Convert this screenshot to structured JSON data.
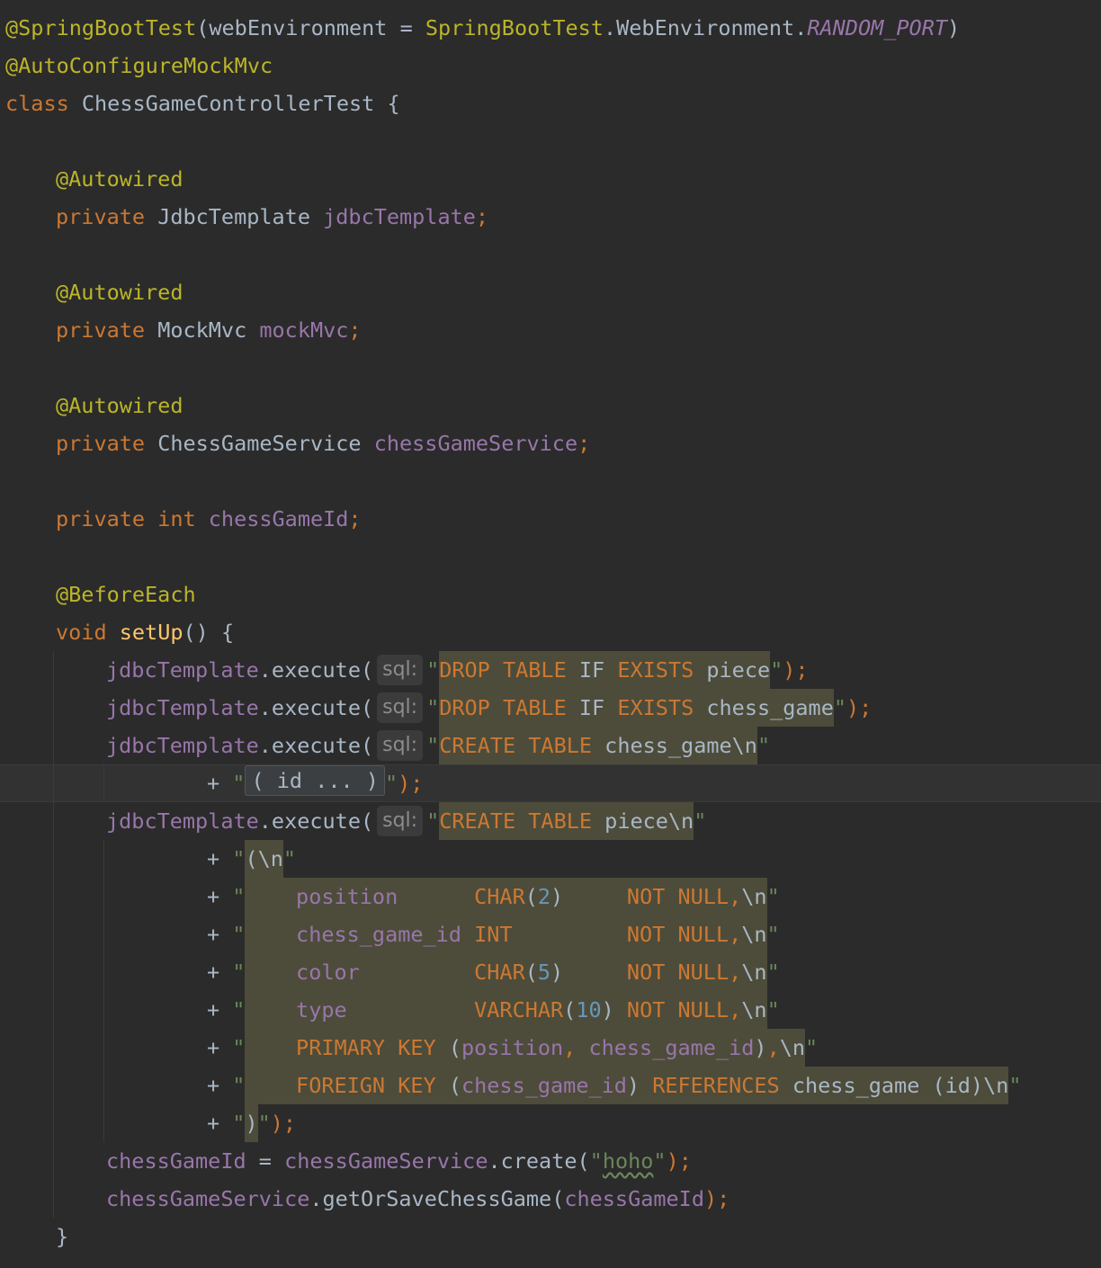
{
  "editor": {
    "lines": [
      {
        "indent": 0,
        "segments": [
          {
            "t": "@SpringBootTest",
            "c": "ann"
          },
          {
            "t": "(webEnvironment = ",
            "c": "plain"
          },
          {
            "t": "SpringBootTest",
            "c": "ann"
          },
          {
            "t": ".WebEnvironment.",
            "c": "plain"
          },
          {
            "t": "RANDOM_PORT",
            "c": "stat"
          },
          {
            "t": ")",
            "c": "plain"
          }
        ]
      },
      {
        "indent": 0,
        "segments": [
          {
            "t": "@AutoConfigureMockMvc",
            "c": "ann"
          }
        ]
      },
      {
        "indent": 0,
        "segments": [
          {
            "t": "class ",
            "c": "kw"
          },
          {
            "t": "ChessGameControllerTest {",
            "c": "plain"
          }
        ]
      },
      {
        "indent": 0,
        "segments": []
      },
      {
        "indent": 4,
        "segments": [
          {
            "t": "@Autowired",
            "c": "ann"
          }
        ]
      },
      {
        "indent": 4,
        "segments": [
          {
            "t": "private ",
            "c": "kw"
          },
          {
            "t": "JdbcTemplate ",
            "c": "plain"
          },
          {
            "t": "jdbcTemplate",
            "c": "fld"
          },
          {
            "t": ";",
            "c": "punct"
          }
        ]
      },
      {
        "indent": 0,
        "segments": []
      },
      {
        "indent": 4,
        "segments": [
          {
            "t": "@Autowired",
            "c": "ann"
          }
        ]
      },
      {
        "indent": 4,
        "segments": [
          {
            "t": "private ",
            "c": "kw"
          },
          {
            "t": "MockMvc ",
            "c": "plain"
          },
          {
            "t": "mockMvc",
            "c": "fld"
          },
          {
            "t": ";",
            "c": "punct"
          }
        ]
      },
      {
        "indent": 0,
        "segments": []
      },
      {
        "indent": 4,
        "segments": [
          {
            "t": "@Autowired",
            "c": "ann"
          }
        ]
      },
      {
        "indent": 4,
        "segments": [
          {
            "t": "private ",
            "c": "kw"
          },
          {
            "t": "ChessGameService ",
            "c": "plain"
          },
          {
            "t": "chessGameService",
            "c": "fld"
          },
          {
            "t": ";",
            "c": "punct"
          }
        ]
      },
      {
        "indent": 0,
        "segments": []
      },
      {
        "indent": 4,
        "segments": [
          {
            "t": "private ",
            "c": "kw"
          },
          {
            "t": "int ",
            "c": "kw"
          },
          {
            "t": "chessGameId",
            "c": "fld"
          },
          {
            "t": ";",
            "c": "punct"
          }
        ]
      },
      {
        "indent": 0,
        "segments": []
      },
      {
        "indent": 4,
        "segments": [
          {
            "t": "@BeforeEach",
            "c": "ann"
          }
        ]
      },
      {
        "indent": 4,
        "segments": [
          {
            "t": "void ",
            "c": "kw"
          },
          {
            "t": "setUp",
            "c": "fn"
          },
          {
            "t": "() {",
            "c": "plain"
          }
        ]
      },
      {
        "indent": 8,
        "segments": [
          {
            "t": "jdbcTemplate",
            "c": "fld"
          },
          {
            "t": ".execute(",
            "c": "plain"
          },
          {
            "hint": "sql:"
          },
          {
            "t": "\"",
            "c": "str"
          },
          {
            "t": "DROP ",
            "c": "kw",
            "inj": true
          },
          {
            "t": "TABLE ",
            "c": "kw",
            "inj": true
          },
          {
            "t": "IF ",
            "c": "plain",
            "inj": true
          },
          {
            "t": "EXISTS ",
            "c": "kw",
            "inj": true
          },
          {
            "t": "piece",
            "c": "plain",
            "inj": true
          },
          {
            "t": "\"",
            "c": "str"
          },
          {
            "t": ");",
            "c": "punct"
          }
        ]
      },
      {
        "indent": 8,
        "segments": [
          {
            "t": "jdbcTemplate",
            "c": "fld"
          },
          {
            "t": ".execute(",
            "c": "plain"
          },
          {
            "hint": "sql:"
          },
          {
            "t": "\"",
            "c": "str"
          },
          {
            "t": "DROP ",
            "c": "kw",
            "inj": true
          },
          {
            "t": "TABLE ",
            "c": "kw",
            "inj": true
          },
          {
            "t": "IF ",
            "c": "plain",
            "inj": true
          },
          {
            "t": "EXISTS ",
            "c": "kw",
            "inj": true
          },
          {
            "t": "chess_game",
            "c": "plain",
            "inj": true
          },
          {
            "t": "\"",
            "c": "str"
          },
          {
            "t": ");",
            "c": "punct"
          }
        ]
      },
      {
        "indent": 8,
        "segments": [
          {
            "t": "jdbcTemplate",
            "c": "fld"
          },
          {
            "t": ".execute(",
            "c": "plain"
          },
          {
            "hint": "sql:"
          },
          {
            "t": "\"",
            "c": "str"
          },
          {
            "t": "CREATE ",
            "c": "kw",
            "inj": true
          },
          {
            "t": "TABLE ",
            "c": "kw",
            "inj": true
          },
          {
            "t": "chess_game\\n",
            "c": "plain",
            "inj": true
          },
          {
            "t": "\"",
            "c": "str"
          }
        ]
      },
      {
        "indent": 16,
        "segments": [
          {
            "t": "+ ",
            "c": "plain"
          },
          {
            "t": "\"",
            "c": "str"
          },
          {
            "fold": "( id ... )"
          },
          {
            "t": "\"",
            "c": "str"
          },
          {
            "t": ");",
            "c": "punct"
          }
        ]
      },
      {
        "indent": 8,
        "segments": [
          {
            "t": "jdbcTemplate",
            "c": "fld"
          },
          {
            "t": ".execute(",
            "c": "plain"
          },
          {
            "hint": "sql:"
          },
          {
            "t": "\"",
            "c": "str"
          },
          {
            "t": "CREATE ",
            "c": "kw",
            "inj": true
          },
          {
            "t": "TABLE ",
            "c": "kw",
            "inj": true
          },
          {
            "t": "piece\\n",
            "c": "plain",
            "inj": true
          },
          {
            "t": "\"",
            "c": "str"
          }
        ]
      },
      {
        "indent": 16,
        "segments": [
          {
            "t": "+ ",
            "c": "plain"
          },
          {
            "t": "\"",
            "c": "str"
          },
          {
            "t": "(\\n",
            "c": "plain",
            "inj": true
          },
          {
            "t": "\"",
            "c": "str"
          }
        ]
      },
      {
        "indent": 16,
        "segments": [
          {
            "t": "+ ",
            "c": "plain"
          },
          {
            "t": "\"",
            "c": "str"
          },
          {
            "t": "    ",
            "c": "plain",
            "inj": true
          },
          {
            "t": "position      ",
            "c": "fld",
            "inj": true
          },
          {
            "t": "CHAR",
            "c": "kw",
            "inj": true
          },
          {
            "t": "(",
            "c": "plain",
            "inj": true
          },
          {
            "t": "2",
            "c": "num",
            "inj": true
          },
          {
            "t": ")     ",
            "c": "plain",
            "inj": true
          },
          {
            "t": "NOT ",
            "c": "kw",
            "inj": true
          },
          {
            "t": "NULL",
            "c": "kw",
            "inj": true
          },
          {
            "t": ",",
            "c": "punct",
            "inj": true
          },
          {
            "t": "\\n",
            "c": "plain",
            "inj": true
          },
          {
            "t": "\"",
            "c": "str"
          }
        ]
      },
      {
        "indent": 16,
        "segments": [
          {
            "t": "+ ",
            "c": "plain"
          },
          {
            "t": "\"",
            "c": "str"
          },
          {
            "t": "    ",
            "c": "plain",
            "inj": true
          },
          {
            "t": "chess_game_id ",
            "c": "fld",
            "inj": true
          },
          {
            "t": "INT         ",
            "c": "kw",
            "inj": true
          },
          {
            "t": "NOT ",
            "c": "kw",
            "inj": true
          },
          {
            "t": "NULL",
            "c": "kw",
            "inj": true
          },
          {
            "t": ",",
            "c": "punct",
            "inj": true
          },
          {
            "t": "\\n",
            "c": "plain",
            "inj": true
          },
          {
            "t": "\"",
            "c": "str"
          }
        ]
      },
      {
        "indent": 16,
        "segments": [
          {
            "t": "+ ",
            "c": "plain"
          },
          {
            "t": "\"",
            "c": "str"
          },
          {
            "t": "    ",
            "c": "plain",
            "inj": true
          },
          {
            "t": "color         ",
            "c": "fld",
            "inj": true
          },
          {
            "t": "CHAR",
            "c": "kw",
            "inj": true
          },
          {
            "t": "(",
            "c": "plain",
            "inj": true
          },
          {
            "t": "5",
            "c": "num",
            "inj": true
          },
          {
            "t": ")     ",
            "c": "plain",
            "inj": true
          },
          {
            "t": "NOT ",
            "c": "kw",
            "inj": true
          },
          {
            "t": "NULL",
            "c": "kw",
            "inj": true
          },
          {
            "t": ",",
            "c": "punct",
            "inj": true
          },
          {
            "t": "\\n",
            "c": "plain",
            "inj": true
          },
          {
            "t": "\"",
            "c": "str"
          }
        ]
      },
      {
        "indent": 16,
        "segments": [
          {
            "t": "+ ",
            "c": "plain"
          },
          {
            "t": "\"",
            "c": "str"
          },
          {
            "t": "    ",
            "c": "plain",
            "inj": true
          },
          {
            "t": "type          ",
            "c": "fld",
            "inj": true
          },
          {
            "t": "VARCHAR",
            "c": "kw",
            "inj": true
          },
          {
            "t": "(",
            "c": "plain",
            "inj": true
          },
          {
            "t": "10",
            "c": "num",
            "inj": true
          },
          {
            "t": ") ",
            "c": "plain",
            "inj": true
          },
          {
            "t": "NOT ",
            "c": "kw",
            "inj": true
          },
          {
            "t": "NULL",
            "c": "kw",
            "inj": true
          },
          {
            "t": ",",
            "c": "punct",
            "inj": true
          },
          {
            "t": "\\n",
            "c": "plain",
            "inj": true
          },
          {
            "t": "\"",
            "c": "str"
          }
        ]
      },
      {
        "indent": 16,
        "segments": [
          {
            "t": "+ ",
            "c": "plain"
          },
          {
            "t": "\"",
            "c": "str"
          },
          {
            "t": "    ",
            "c": "plain",
            "inj": true
          },
          {
            "t": "PRIMARY ",
            "c": "kw",
            "inj": true
          },
          {
            "t": "KEY ",
            "c": "kw",
            "inj": true
          },
          {
            "t": "(",
            "c": "plain",
            "inj": true
          },
          {
            "t": "position",
            "c": "fld",
            "inj": true
          },
          {
            "t": ", ",
            "c": "punct",
            "inj": true
          },
          {
            "t": "chess_game_id",
            "c": "fld",
            "inj": true
          },
          {
            "t": ")",
            "c": "plain",
            "inj": true
          },
          {
            "t": ",",
            "c": "punct",
            "inj": true
          },
          {
            "t": "\\n",
            "c": "plain",
            "inj": true
          },
          {
            "t": "\"",
            "c": "str"
          }
        ]
      },
      {
        "indent": 16,
        "segments": [
          {
            "t": "+ ",
            "c": "plain"
          },
          {
            "t": "\"",
            "c": "str"
          },
          {
            "t": "    ",
            "c": "plain",
            "inj": true
          },
          {
            "t": "FOREIGN ",
            "c": "kw",
            "inj": true
          },
          {
            "t": "KEY ",
            "c": "kw",
            "inj": true
          },
          {
            "t": "(",
            "c": "plain",
            "inj": true
          },
          {
            "t": "chess_game_id",
            "c": "fld",
            "inj": true
          },
          {
            "t": ") ",
            "c": "plain",
            "inj": true
          },
          {
            "t": "REFERENCES ",
            "c": "kw",
            "inj": true
          },
          {
            "t": "chess_game (id)\\n",
            "c": "plain",
            "inj": true
          },
          {
            "t": "\"",
            "c": "str"
          }
        ]
      },
      {
        "indent": 16,
        "segments": [
          {
            "t": "+ ",
            "c": "plain"
          },
          {
            "t": "\"",
            "c": "str"
          },
          {
            "t": ")",
            "c": "plain",
            "inj": true
          },
          {
            "t": "\"",
            "c": "str"
          },
          {
            "t": ");",
            "c": "punct"
          }
        ]
      },
      {
        "indent": 8,
        "segments": [
          {
            "t": "chessGameId",
            "c": "fld"
          },
          {
            "t": " = ",
            "c": "plain"
          },
          {
            "t": "chessGameService",
            "c": "fld"
          },
          {
            "t": ".create(",
            "c": "plain"
          },
          {
            "t": "\"",
            "c": "str"
          },
          {
            "t": "hoho",
            "c": "str",
            "squiggle": true
          },
          {
            "t": "\"",
            "c": "str"
          },
          {
            "t": ");",
            "c": "punct"
          }
        ]
      },
      {
        "indent": 8,
        "segments": [
          {
            "t": "chessGameService",
            "c": "fld"
          },
          {
            "t": ".getOrSaveChessGame(",
            "c": "plain"
          },
          {
            "t": "chessGameId",
            "c": "fld"
          },
          {
            "t": ");",
            "c": "punct"
          }
        ]
      },
      {
        "indent": 4,
        "segments": [
          {
            "t": "}",
            "c": "plain"
          }
        ]
      }
    ]
  }
}
